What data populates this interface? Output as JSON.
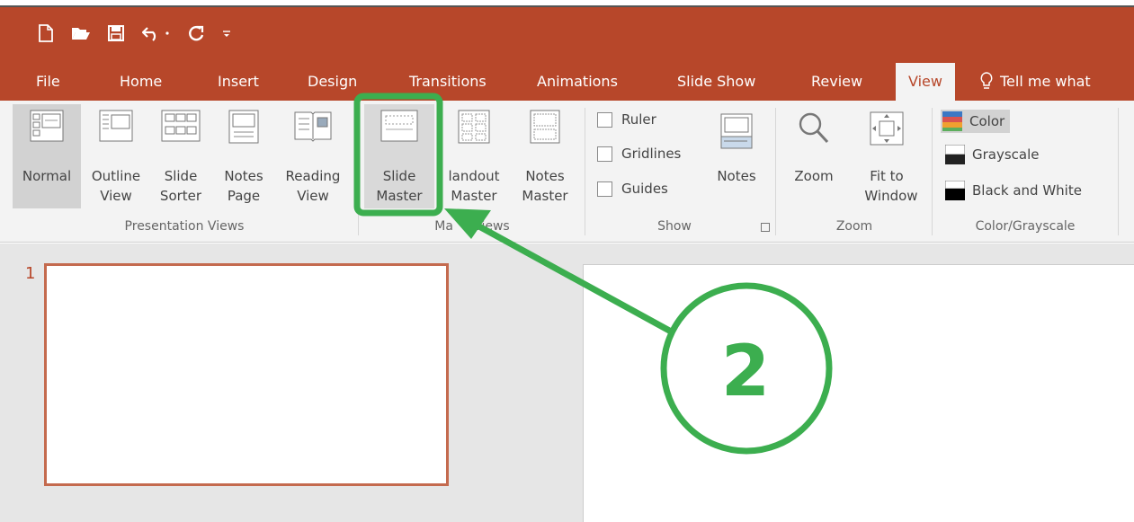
{
  "quick_access": {
    "icons": [
      "new-file-icon",
      "open-folder-icon",
      "save-icon",
      "undo-icon",
      "undo-dropdown-icon",
      "redo-icon",
      "customize-qat-icon"
    ]
  },
  "tabs": [
    {
      "label": "File"
    },
    {
      "label": "Home"
    },
    {
      "label": "Insert"
    },
    {
      "label": "Design"
    },
    {
      "label": "Transitions"
    },
    {
      "label": "Animations"
    },
    {
      "label": "Slide Show"
    },
    {
      "label": "Review"
    },
    {
      "label": "View",
      "active": true
    }
  ],
  "tell_me": {
    "label": "Tell me what",
    "icon": "lightbulb-icon"
  },
  "ribbon": {
    "presentation_views": {
      "label": "Presentation Views",
      "buttons": [
        {
          "line1": "Normal",
          "line2": "",
          "selected": true
        },
        {
          "line1": "Outline",
          "line2": "View"
        },
        {
          "line1": "Slide",
          "line2": "Sorter"
        },
        {
          "line1": "Notes",
          "line2": "Page"
        },
        {
          "line1": "Reading",
          "line2": "View"
        }
      ]
    },
    "master_views": {
      "label": "Master Views",
      "label_visible": "Ma     Views",
      "buttons": [
        {
          "line1": "Slide",
          "line2": "Master",
          "highlighted": true
        },
        {
          "line1": "Handout",
          "line1_visible": "landout",
          "line2": "Master"
        },
        {
          "line1": "Notes",
          "line2": "Master"
        }
      ]
    },
    "show": {
      "label": "Show",
      "checkboxes": [
        {
          "label": "Ruler",
          "checked": false
        },
        {
          "label": "Gridlines",
          "checked": false
        },
        {
          "label": "Guides",
          "checked": false
        }
      ],
      "notes_button": {
        "label": "Notes"
      }
    },
    "zoom": {
      "label": "Zoom",
      "zoom_button": {
        "label": "Zoom"
      },
      "fit_button": {
        "line1": "Fit to",
        "line2": "Window"
      }
    },
    "color_grayscale": {
      "label": "Color/Grayscale",
      "options": [
        {
          "label": "Color",
          "selected": true
        },
        {
          "label": "Grayscale"
        },
        {
          "label": "Black and White"
        }
      ]
    }
  },
  "slides": [
    {
      "number": "1"
    }
  ],
  "annotation": {
    "number": "2",
    "color": "#3cae4f"
  },
  "colors": {
    "accent": "#b7472a",
    "callout": "#3cae4f",
    "thumb_border": "#c46a4e"
  }
}
